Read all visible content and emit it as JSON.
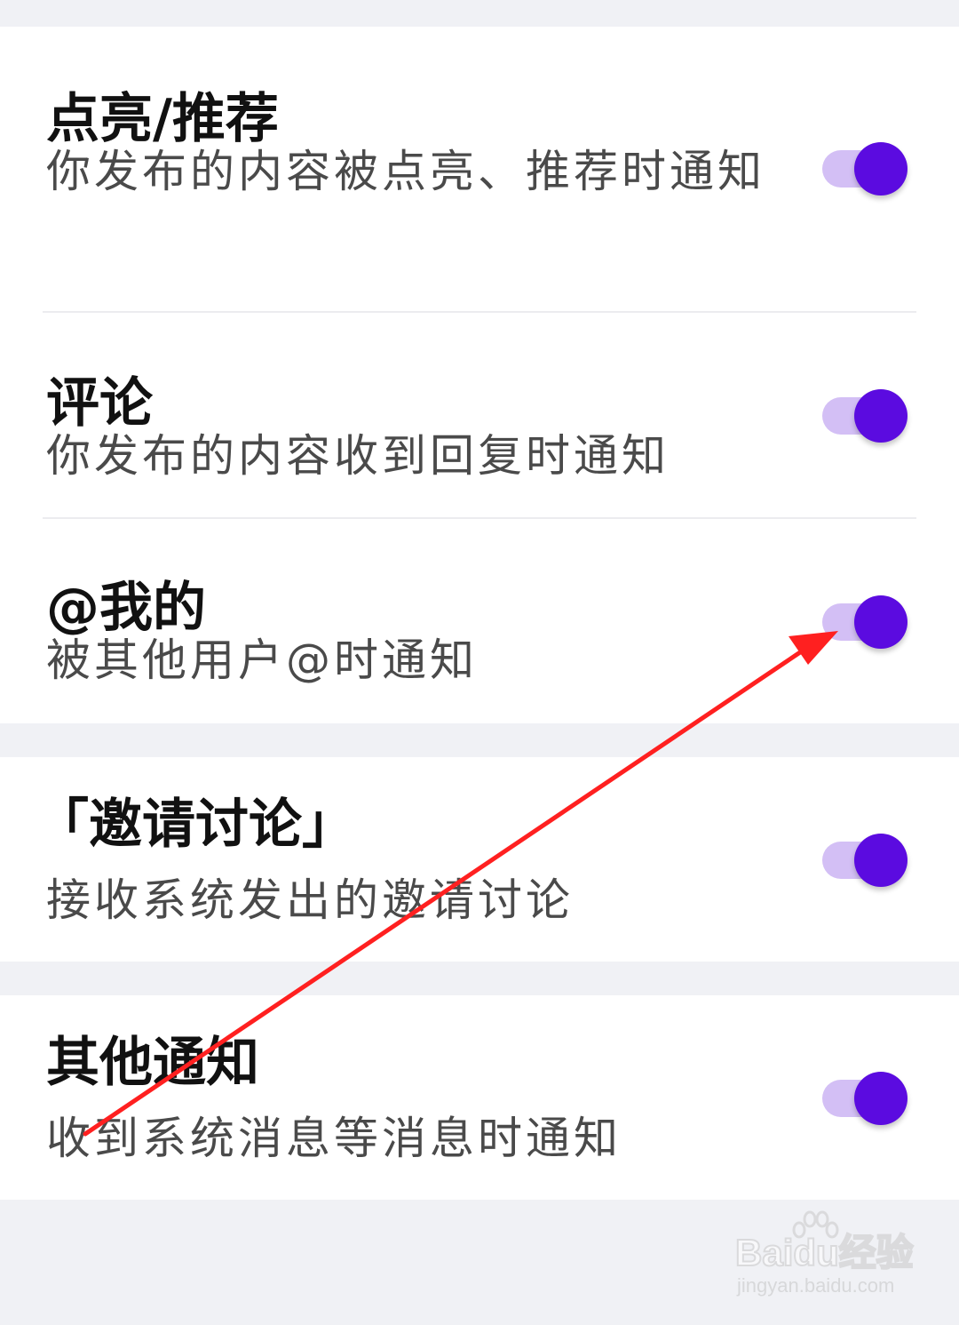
{
  "theme": {
    "accent": "#5b0be0",
    "track": "#d3bff5",
    "background": "#f0f1f5",
    "annotation": "#ff2020"
  },
  "groups": [
    {
      "items": [
        {
          "title": "点亮/推荐",
          "desc": "你发布的内容被点亮、推荐时通知",
          "enabled": true
        },
        {
          "title": "评论",
          "desc": "你发布的内容收到回复时通知",
          "enabled": true
        },
        {
          "title": "@我的",
          "desc": "被其他用户@时通知",
          "enabled": true
        }
      ]
    },
    {
      "items": [
        {
          "title": "「邀请讨论」",
          "desc": "接收系统发出的邀请讨论",
          "enabled": true
        }
      ]
    },
    {
      "items": [
        {
          "title": "其他通知",
          "desc": "收到系统消息等消息时通知",
          "enabled": true
        }
      ]
    }
  ],
  "watermark": {
    "logo": "Baidu经验",
    "url": "jingyan.baidu.com"
  }
}
